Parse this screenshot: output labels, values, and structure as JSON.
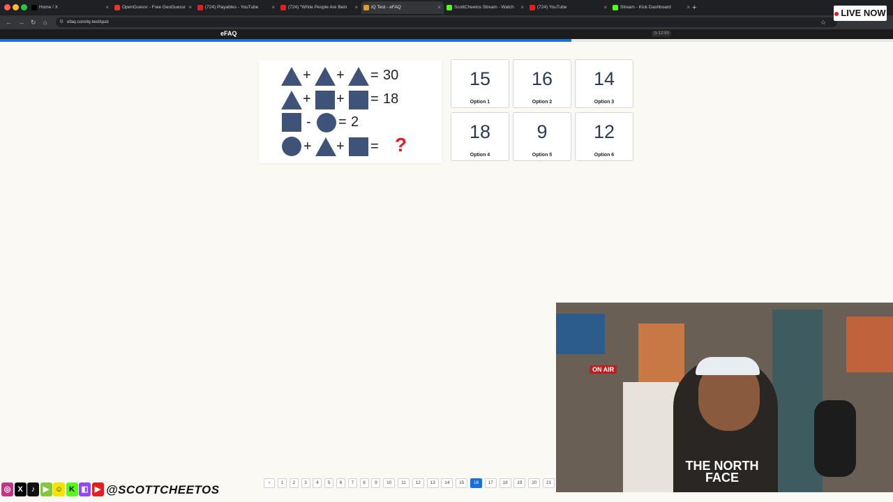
{
  "browser": {
    "tabs": [
      {
        "title": "Home / X",
        "icon": "x-icon",
        "color": "#000000",
        "active": false
      },
      {
        "title": "OpenGuessr - Free GeoGuessr",
        "icon": "openguessr-icon",
        "color": "#e0392b",
        "active": false
      },
      {
        "title": "(724) Playables - YouTube",
        "icon": "youtube-icon",
        "color": "#e02020",
        "active": false
      },
      {
        "title": "(724) \"White People Are Bein",
        "icon": "youtube-icon",
        "color": "#e02020",
        "active": false
      },
      {
        "title": "IQ Test - eFAQ",
        "icon": "efaq-icon",
        "color": "#e09b2b",
        "active": true
      },
      {
        "title": "ScottCheetos Stream - Watch",
        "icon": "kick-icon",
        "color": "#53fc18",
        "active": false
      },
      {
        "title": "(724) YouTube",
        "icon": "youtube-icon",
        "color": "#e02020",
        "active": false
      },
      {
        "title": "Stream - Kick Dashboard",
        "icon": "kick-icon",
        "color": "#53fc18",
        "active": false
      }
    ],
    "new_tab": "+",
    "url": "efaq.com/iq-test/quiz"
  },
  "live_badge": "LIVE NOW",
  "site": {
    "logo": "eFAQ",
    "timer": "12:50",
    "progress_fraction": 0.64,
    "accent": "#1b6fd8"
  },
  "puzzle": {
    "plus": "+",
    "minus": "-",
    "equals": "=",
    "row1_result": "30",
    "row2_result": "18",
    "row3_result": "2",
    "question_mark": "?",
    "shape_color": "#3f5378"
  },
  "options": [
    {
      "value": "15",
      "label": "Option 1"
    },
    {
      "value": "16",
      "label": "Option 2"
    },
    {
      "value": "14",
      "label": "Option 3"
    },
    {
      "value": "18",
      "label": "Option 4"
    },
    {
      "value": "9",
      "label": "Option 5"
    },
    {
      "value": "12",
      "label": "Option 6"
    }
  ],
  "pagination": {
    "prev": "‹",
    "pages": [
      "1",
      "2",
      "3",
      "4",
      "5",
      "6",
      "7",
      "8",
      "9",
      "10",
      "11",
      "12",
      "13",
      "14",
      "15",
      "16",
      "17",
      "18",
      "19",
      "20",
      "21"
    ],
    "current": "16"
  },
  "webcam": {
    "on_air": "ON AIR",
    "shirt_text": "THE NORTH FACE"
  },
  "social": {
    "icons": [
      "instagram-icon",
      "x-icon",
      "tiktok-icon",
      "rumble-icon",
      "snapchat-icon",
      "kick-icon",
      "twitch-icon",
      "youtube-icon"
    ],
    "handle": "@SCOTTCHEETOS"
  }
}
